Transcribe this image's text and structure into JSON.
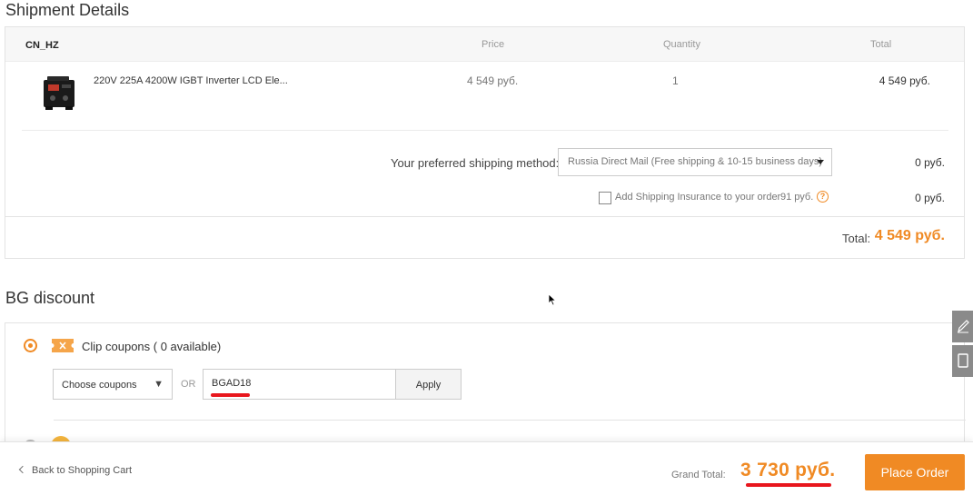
{
  "shipment": {
    "title": "Shipment Details",
    "store": "CN_HZ",
    "columns": {
      "price": "Price",
      "quantity": "Quantity",
      "total": "Total"
    },
    "product": {
      "name": "220V 225A 4200W IGBT Inverter LCD Ele...",
      "price": "4 549 руб.",
      "quantity": "1",
      "total": "4 549 руб."
    },
    "shipping_method_label": "Your preferred shipping method:",
    "shipping_method_value": "Russia Direct Mail (Free shipping & 10-15 business days)",
    "shipping_cost": "0 руб.",
    "insurance_label": "Add Shipping Insurance to your order",
    "insurance_price": "91 руб.",
    "insurance_cost": "0 руб.",
    "insurance_checked": false,
    "help_glyph": "?",
    "total_label": "Total:",
    "total_value": "4 549 руб."
  },
  "discount": {
    "title": "BG discount",
    "clip_coupons_label": "Clip coupons ( 0 available)",
    "choose_coupons": "Choose coupons",
    "select_arrow": "▼",
    "or_label": "OR",
    "coupon_code": "BGAD18",
    "apply_label": "Apply"
  },
  "footer": {
    "back_label": "Back to Shopping Cart",
    "grand_total_label": "Grand Total:",
    "grand_total_value": "3 730 руб.",
    "place_order_label": "Place Order"
  },
  "colors": {
    "accent": "#f08a24",
    "annotation_red": "#e8161d"
  },
  "icons": [
    "product-thumbnail",
    "caret-down-icon",
    "help-icon",
    "coupon-icon",
    "chevron-left-icon",
    "edit-icon",
    "tablet-icon",
    "cursor-icon"
  ]
}
